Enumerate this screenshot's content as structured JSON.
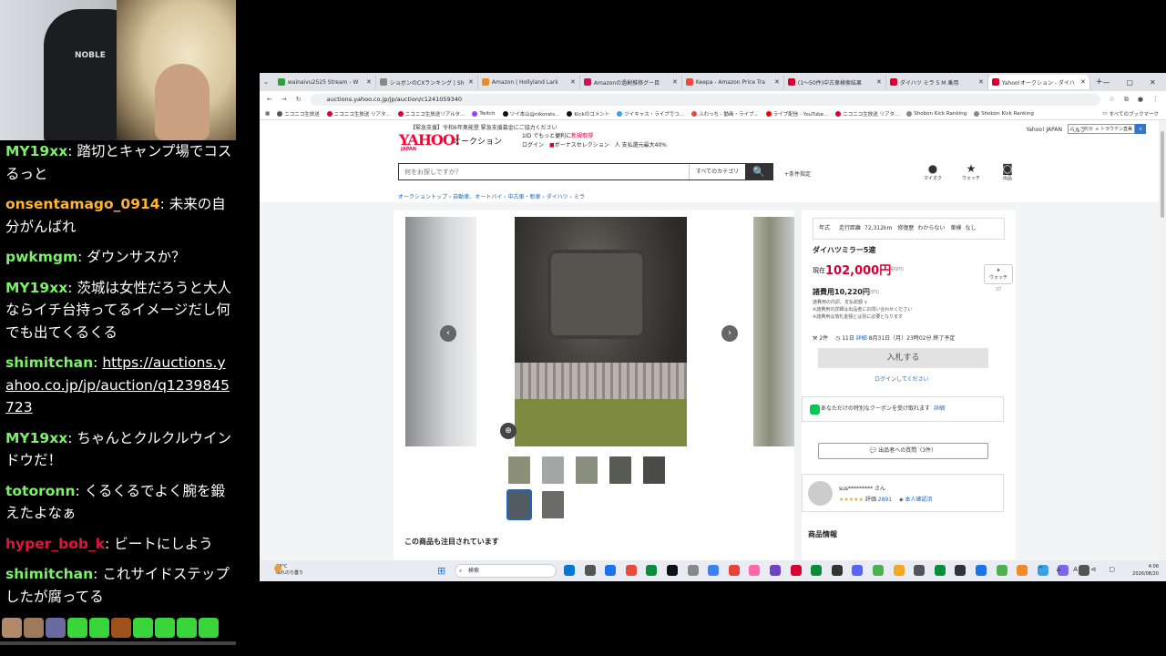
{
  "camera": {
    "chair_brand": "NOBLE"
  },
  "chat": [
    {
      "user": "MY19xx",
      "color": "#7cf06a",
      "text": "踏切とキャンプ場でコスるっと",
      "link": false
    },
    {
      "user": "onsentamago_0914",
      "color": "#ffb52e",
      "text": "未来の自分がんばれ",
      "link": false
    },
    {
      "user": "pwkmgm",
      "color": "#7cf06a",
      "text": "ダウンサスか？",
      "link": false
    },
    {
      "user": "MY19xx",
      "color": "#7cf06a",
      "text": "茨城は女性だろうと大人ならイチ台持ってるイメージだし何でも出てくるくる",
      "link": false
    },
    {
      "user": "shimitchan",
      "color": "#7cf06a",
      "text": "https://auctions.yahoo.co.jp/jp/auction/q1239845723",
      "link": true
    },
    {
      "user": "MY19xx",
      "color": "#7cf06a",
      "text": "ちゃんとクルクルウインドウだ！",
      "link": false
    },
    {
      "user": "totoronn",
      "color": "#7cf06a",
      "text": "くるくるでよく腕を鍛えたよなぁ",
      "link": false
    },
    {
      "user": "hyper_bob_k",
      "color": "#e0163a",
      "text": "ビートにしよう",
      "link": false
    },
    {
      "user": "shimitchan",
      "color": "#7cf06a",
      "text": "これサイドステップしたが腐ってる",
      "link": false
    }
  ],
  "emotes": [
    "#b08a6a",
    "#9c7a5a",
    "#6a6aa0",
    "#39d53a",
    "#39d53a",
    "#a0521d",
    "#39d53a",
    "#39d53a",
    "#39d53a",
    "#39d53a"
  ],
  "browser": {
    "tabs": [
      {
        "label": "wainaivu2525 Stream - W",
        "color": "#2e9e3e",
        "active": false
      },
      {
        "label": "ショボンのCXランキング | Sh",
        "color": "#888888",
        "active": false
      },
      {
        "label": "Amazon | Hollyland Lark",
        "color": "#f08a24",
        "active": false
      },
      {
        "label": "Amazonの過剰推移グー目",
        "color": "#c2185b",
        "active": false
      },
      {
        "label": "Keepa - Amazon Price Tra",
        "color": "#e74c3c",
        "active": false
      },
      {
        "label": "(1〜50件)中古車検索結果",
        "color": "#d70035",
        "active": false
      },
      {
        "label": "ダイハツ ミラ 5 M 乗用",
        "color": "#d70035",
        "active": false
      },
      {
        "label": "Yahoo!オークション - ダイハ",
        "color": "#d70035",
        "active": true
      }
    ],
    "url": "auctions.yahoo.co.jp/jp/auction/c1241059340",
    "bookmarks": [
      {
        "label": "ニコニコ生放送",
        "color": "#555555"
      },
      {
        "label": "ニコニコ生放送 リアタ...",
        "color": "#d70035"
      },
      {
        "label": "ニコニコ生放送リアルタ...",
        "color": "#d70035"
      },
      {
        "label": "Twitch",
        "color": "#9146ff"
      },
      {
        "label": "ツイ本山@nikorats...",
        "color": "#111111"
      },
      {
        "label": "Kickのコメント",
        "color": "#111111"
      },
      {
        "label": "ツイキャス・ライブでつ...",
        "color": "#3aa3e3"
      },
      {
        "label": "ふわっち - 動画・ライブ...",
        "color": "#e74c3c"
      },
      {
        "label": "ライブ配信 - YouTube...",
        "color": "#ff0000"
      },
      {
        "label": "ニコニコ生放送 リアタ...",
        "color": "#d70035"
      },
      {
        "label": "Shobon Kick Ranking",
        "color": "#888888"
      },
      {
        "label": "Shobon Kick Ranking",
        "color": "#888888"
      }
    ],
    "bookmarks_all": "すべてのブックマーク"
  },
  "yahoo": {
    "notice": "【緊急支援】令和6年奥能登 緊急支援募金にご協力ください",
    "top_links": [
      "Yahoo! JAPAN",
      "ヘルプ"
    ],
    "mini_search_placeholder": "ウェブ検索",
    "mini_search_extra": "+ トラウデン直美",
    "logo": "YAHOO!",
    "logo_sub": "JAPAN",
    "logo_auction": "オークション",
    "promo_line1": "1ID でもっと便利に",
    "promo_line1_red": "新規取得",
    "promo_line2a": "ログイン",
    "promo_line2b": "ボーナスセレクション",
    "promo_line2c": "人 支払還元最大40%",
    "search_placeholder": "何をお探しですか？",
    "search_category": "すべてのカテゴリ",
    "search_go": "🔍",
    "conditions": "+条件指定",
    "header_icons": [
      {
        "glyph": "●",
        "label": "マイオク"
      },
      {
        "glyph": "★",
        "label": "ウォッチ"
      },
      {
        "glyph": "◙",
        "label": "出品"
      }
    ],
    "breadcrumbs": [
      "オークショントップ",
      "自動車、オートバイ",
      "中古車・新車",
      "ダイハツ",
      "ミラ"
    ]
  },
  "item": {
    "spec_items": [
      {
        "k": "年式",
        "v": ""
      },
      {
        "k": "走行距離",
        "v": "72,312km"
      },
      {
        "k": "修復歴",
        "v": "わからない"
      },
      {
        "k": "車検",
        "v": "なし"
      }
    ],
    "title": "ダイハツミラー5速",
    "price_label": "現在",
    "price": "102,000円",
    "tax": "(税0円)",
    "watch_label": "ウォッチ",
    "watch_count": "37",
    "buynow": "諸費用10,220円",
    "buynow_tax": "(税0円)",
    "notes": [
      "諸費用の内訳、支払総額 ∨",
      "※諸費用の詳細は出品者にお問い合わせください",
      "※諸費用は落札金額とは別に必要となります"
    ],
    "bids": "2件",
    "time": "11日",
    "time_detail": "詳細",
    "end_date": "8月31日（月）23時02分 終了予定",
    "bid_button": "入札する",
    "login_link": "ログインしてください",
    "coupon_text": "あなただけの特別なクーポンを受け取れます",
    "coupon_link": "詳細",
    "ask_button": "💬 出品者への質問（3件）",
    "seller_name": "sus*********",
    "seller_suffix": "さん",
    "seller_stars": "★★★★★",
    "seller_rating_label": "評価",
    "seller_rating": "2891",
    "seller_verified": "本人確認済",
    "product_info": "商品情報",
    "also_viewed": "この商品も注目されています"
  },
  "thumbs": [
    {
      "color": "#8b8f78",
      "selected": false
    },
    {
      "color": "#a4a7a5",
      "selected": false
    },
    {
      "color": "#8a8e7f",
      "selected": false
    },
    {
      "color": "#585b52",
      "selected": false
    },
    {
      "color": "#4b4c48",
      "selected": false
    },
    {
      "color": "#525b62",
      "selected": true
    },
    {
      "color": "#6b6c68",
      "selected": false
    }
  ],
  "taskbar": {
    "temp": "23°C",
    "weather": "晴れのち曇り",
    "search": "検索",
    "time": "4:06",
    "date": "2026/08/20",
    "tray": "^ ⌂ A ⊲ ▢",
    "icons": [
      "#0078d4",
      "#555555",
      "#1a73e8",
      "#e74c3c",
      "#0b8d3a",
      "#111111",
      "#888888",
      "#3b82f6",
      "#ea4335",
      "#ff66aa",
      "#6f42c1",
      "#d70035",
      "#0b8d3a",
      "#333333",
      "#5865f2",
      "#4caf50",
      "#f5a623",
      "#555555",
      "#0b8d3a",
      "#333333",
      "#1a73e8",
      "#4caf50",
      "#f08a24",
      "#3aa3e3",
      "#7b68ee",
      "#555555"
    ]
  }
}
